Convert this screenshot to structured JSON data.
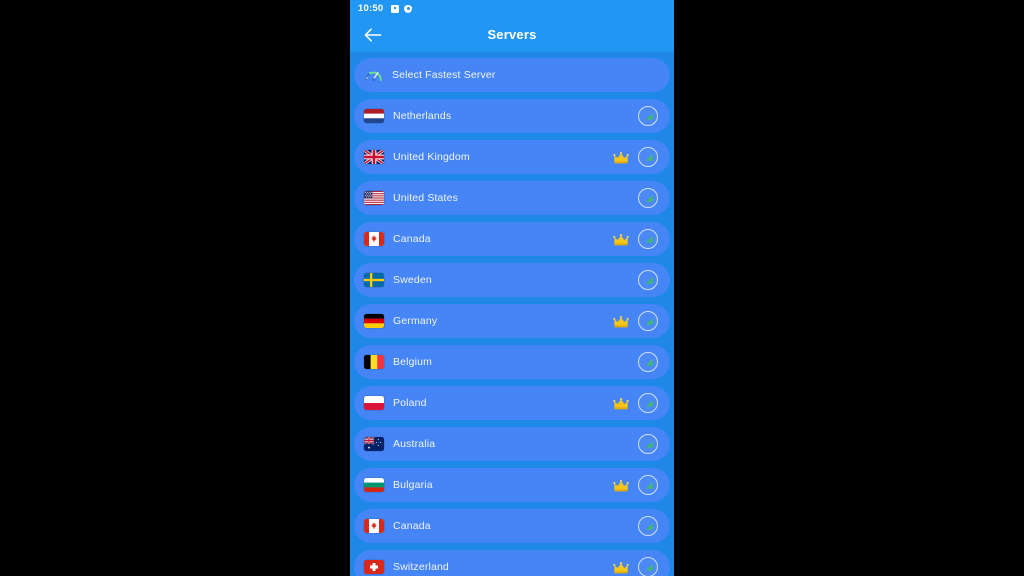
{
  "statusbar": {
    "time": "10:50",
    "icons": [
      "sd-card-icon",
      "shield-icon"
    ]
  },
  "appbar": {
    "title": "Servers",
    "back_icon": "back-arrow-icon"
  },
  "colors": {
    "page_background": "#000000",
    "app_bar": "#2196f3",
    "list_background": "#1f87e5",
    "row": "#4585f5",
    "row_text": "#f0f4ff",
    "crown": "#f5c518",
    "signal_ring": "#cfe0ff",
    "signal_fill": "#3dba6e"
  },
  "fastest": {
    "label": "Select Fastest Server",
    "icon": "speed-gauge-icon"
  },
  "servers": [
    {
      "name": "Netherlands",
      "flag": "nl",
      "premium": false
    },
    {
      "name": "United Kingdom",
      "flag": "gb",
      "premium": true
    },
    {
      "name": "United States",
      "flag": "us",
      "premium": false
    },
    {
      "name": "Canada",
      "flag": "ca",
      "premium": true
    },
    {
      "name": "Sweden",
      "flag": "se",
      "premium": false
    },
    {
      "name": "Germany",
      "flag": "de",
      "premium": true
    },
    {
      "name": "Belgium",
      "flag": "be",
      "premium": false
    },
    {
      "name": "Poland",
      "flag": "pl",
      "premium": true
    },
    {
      "name": "Australia",
      "flag": "au",
      "premium": false
    },
    {
      "name": "Bulgaria",
      "flag": "bg",
      "premium": true
    },
    {
      "name": "Canada",
      "flag": "ca",
      "premium": false
    },
    {
      "name": "Switzerland",
      "flag": "ch",
      "premium": true
    }
  ]
}
